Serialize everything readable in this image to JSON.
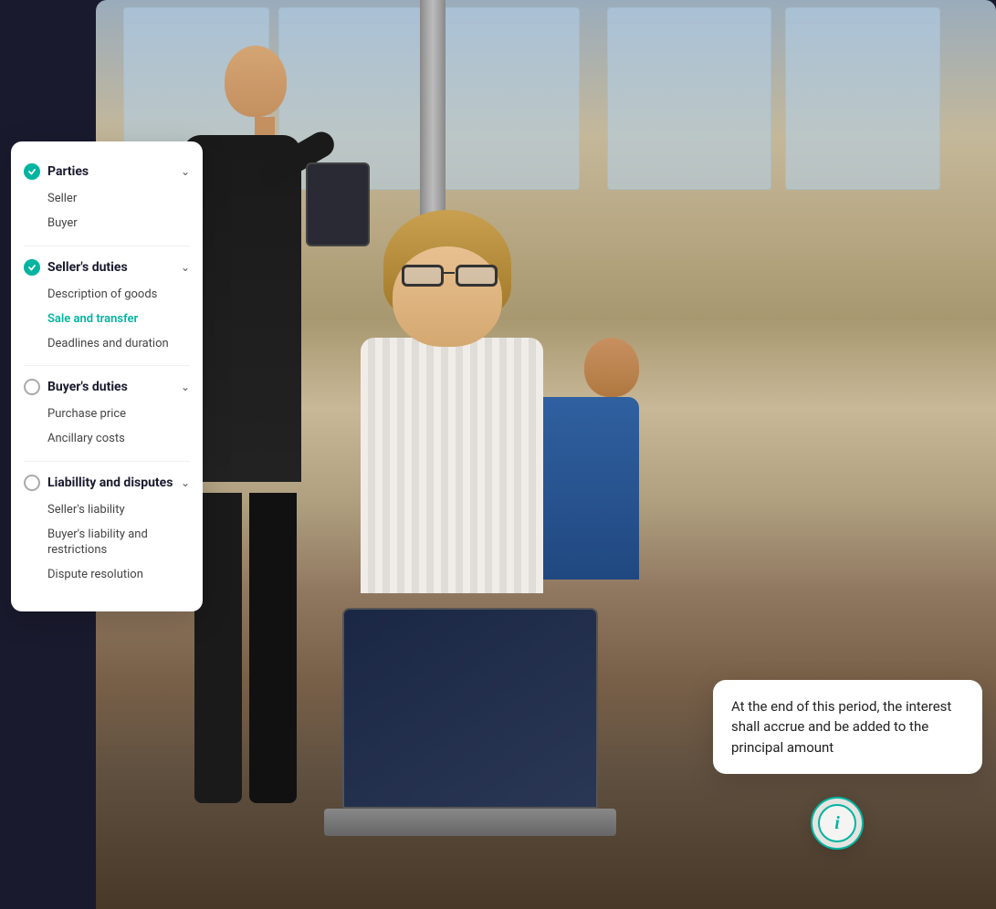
{
  "sidebar": {
    "sections": [
      {
        "id": "parties",
        "title": "Parties",
        "status": "complete",
        "expanded": true,
        "items": [
          {
            "label": "Seller",
            "active": false
          },
          {
            "label": "Buyer",
            "active": false
          }
        ]
      },
      {
        "id": "sellers-duties",
        "title": "Seller's duties",
        "status": "complete",
        "expanded": true,
        "items": [
          {
            "label": "Description of goods",
            "active": false
          },
          {
            "label": "Sale and transfer",
            "active": true
          },
          {
            "label": "Deadlines and duration",
            "active": false
          }
        ]
      },
      {
        "id": "buyers-duties",
        "title": "Buyer's duties",
        "status": "empty",
        "expanded": true,
        "items": [
          {
            "label": "Purchase price",
            "active": false
          },
          {
            "label": "Ancillary costs",
            "active": false
          }
        ]
      },
      {
        "id": "liability-disputes",
        "title": "Liabillity and disputes",
        "status": "empty",
        "expanded": true,
        "items": [
          {
            "label": "Seller's liability",
            "active": false
          },
          {
            "label": "Buyer's liability and restrictions",
            "active": false
          },
          {
            "label": "Dispute resolution",
            "active": false
          }
        ]
      }
    ]
  },
  "tooltip": {
    "text": "At the end of this period, the interest shall accrue and be added to the principal amount"
  },
  "info_button": {
    "icon": "i"
  },
  "icons": {
    "checkmark": "✓",
    "chevron": "∨"
  }
}
